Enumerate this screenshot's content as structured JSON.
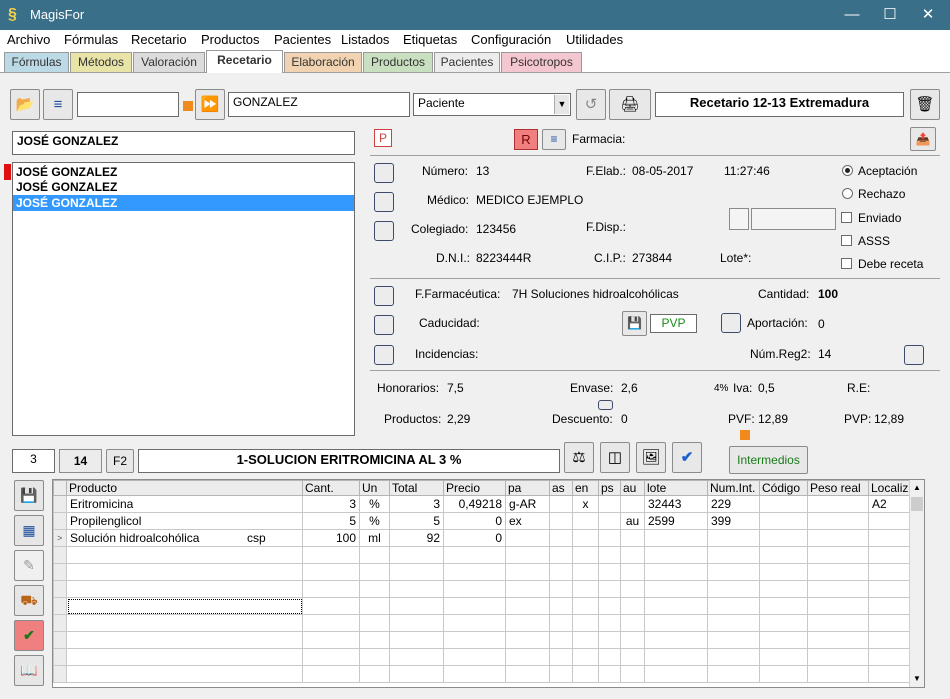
{
  "window": {
    "title": "MagisFor",
    "logo_glyph": "§"
  },
  "menu": [
    "Archivo",
    "Fórmulas",
    "Recetario",
    "Productos",
    "Pacientes",
    "Listados",
    "Etiquetas",
    "Configuración",
    "Utilidades"
  ],
  "tabs": [
    {
      "label": "Fórmulas",
      "color": "#bcd9e6"
    },
    {
      "label": "Métodos",
      "color": "#e8e3a6"
    },
    {
      "label": "Valoración",
      "color": "#dcdcdc"
    },
    {
      "label": "Recetario",
      "color": "#ffffff"
    },
    {
      "label": "Elaboración",
      "color": "#f2d3b1"
    },
    {
      "label": "Productos",
      "color": "#c9e0c0"
    },
    {
      "label": "Pacientes",
      "color": "#ececec"
    },
    {
      "label": "Psicotropos",
      "color": "#f4c6cf"
    }
  ],
  "toolbar": {
    "search_value": "",
    "patient_name": "GONZALEZ",
    "search_type": "Paciente",
    "recetario_label": "Recetario 12-13 Extremadura"
  },
  "patient": {
    "selected_name": "JOSÉ GONZALEZ",
    "list": [
      "JOSÉ GONZALEZ",
      "JOSÉ GONZALEZ",
      "JOSÉ GONZALEZ"
    ]
  },
  "header": {
    "p_label": "P",
    "r_label": "R",
    "farmacia_label": "Farmacia:"
  },
  "receta": {
    "numero_label": "Número:",
    "numero": "13",
    "felab_label": "F.Elab.:",
    "felab": "08-05-2017",
    "hora": "11:27:46",
    "medico_label": "Médico:",
    "medico": "MEDICO EJEMPLO",
    "colegiado_label": "Colegiado:",
    "colegiado": "123456",
    "fdisp_label": "F.Disp.:",
    "dni_label": "D.N.I.:",
    "dni": "8223444R",
    "cip_label": "C.I.P.:",
    "cip": "273844",
    "lote_label": "Lote*:"
  },
  "status": {
    "aceptacion": "Aceptación",
    "rechazo": "Rechazo",
    "enviado": "Enviado",
    "asss": "ASSS",
    "debe_receta": "Debe receta"
  },
  "formula_info": {
    "ffarm_label": "F.Farmacéutica:",
    "ffarm": "7H Soluciones hidroalcohólicas",
    "cantidad_label": "Cantidad:",
    "cantidad": "100",
    "caducidad_label": "Caducidad:",
    "pvp_button": "PVP",
    "aportacion_label": "Aportación:",
    "aportacion": "0",
    "incidencias_label": "Incidencias:",
    "numreg_label": "Núm.Reg2:",
    "numreg": "14"
  },
  "pricing": {
    "honorarios_label": "Honorarios:",
    "honorarios": "7,5",
    "envase_label": "Envase:",
    "envase": "2,6",
    "iva_pct": "4%",
    "iva_label": "Iva:",
    "iva": "0,5",
    "re_label": "R.E:",
    "productos_label": "Productos:",
    "productos": "2,29",
    "descuento_label": "Descuento:",
    "descuento": "0",
    "pvf_label": "PVF:",
    "pvf": "12,89",
    "pvp_label": "PVP:",
    "pvp": "12,89"
  },
  "formula_bar": {
    "count": "3",
    "num": "14",
    "f2": "F2",
    "name": "1-SOLUCION ERITROMICINA AL 3 %",
    "intermedios": "Intermedios"
  },
  "grid": {
    "columns": [
      "Producto",
      "Cant.",
      "Un",
      "Total",
      "Precio",
      "pa",
      "as",
      "en",
      "ps",
      "au",
      "lote",
      "Num.Int.",
      "Código",
      "Peso real",
      "Localiz"
    ],
    "rows": [
      {
        "marker": "",
        "producto": "Eritromicina",
        "extra": "",
        "cant": "3",
        "un": "%",
        "total": "3",
        "precio": "0,49218",
        "pa": "g-AR",
        "as": "",
        "en": "x",
        "ps": "",
        "au": "",
        "lote": "32443",
        "numint": "229",
        "codigo": "",
        "peso": "",
        "localiz": "A2"
      },
      {
        "marker": "",
        "producto": "Propilenglicol",
        "extra": "",
        "cant": "5",
        "un": "%",
        "total": "5",
        "precio": "0",
        "pa": "ex",
        "as": "",
        "en": "",
        "ps": "",
        "au": "au",
        "lote": "2599",
        "numint": "399",
        "codigo": "",
        "peso": "",
        "localiz": ""
      },
      {
        "marker": ">",
        "producto": "Solución hidroalcohólica",
        "extra": "csp",
        "cant": "100",
        "un": "ml",
        "total": "92",
        "precio": "0",
        "pa": "",
        "as": "",
        "en": "",
        "ps": "",
        "au": "",
        "lote": "",
        "numint": "",
        "codigo": "",
        "peso": "",
        "localiz": ""
      }
    ],
    "empty_rows": 8
  },
  "colors": {
    "titlebar": "#3a6f89",
    "selection": "#3399ff",
    "accent_orange": "#f08a1c"
  }
}
